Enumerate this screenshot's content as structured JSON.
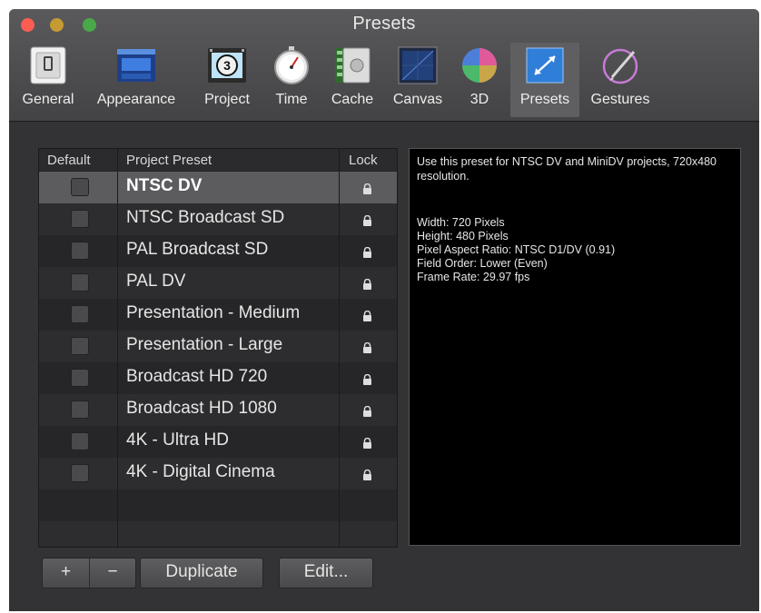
{
  "window": {
    "title": "Presets",
    "controls": [
      "close",
      "minimize",
      "zoom"
    ]
  },
  "toolbar": {
    "items": [
      {
        "label": "General",
        "icon": "switch-icon"
      },
      {
        "label": "Appearance",
        "icon": "window-layout-icon"
      },
      {
        "label": "Project",
        "icon": "film-reel-icon"
      },
      {
        "label": "Time",
        "icon": "stopwatch-icon"
      },
      {
        "label": "Cache",
        "icon": "safe-film-icon"
      },
      {
        "label": "Canvas",
        "icon": "canvas-grid-icon"
      },
      {
        "label": "3D",
        "icon": "sphere-3d-icon"
      },
      {
        "label": "Presets",
        "icon": "resize-arrows-icon",
        "selected": true
      },
      {
        "label": "Gestures",
        "icon": "pen-stroke-icon"
      }
    ]
  },
  "table": {
    "headers": {
      "default": "Default",
      "preset": "Project Preset",
      "lock": "Lock"
    },
    "rows": [
      {
        "name": "NTSC DV",
        "selected": true
      },
      {
        "name": "NTSC Broadcast SD"
      },
      {
        "name": "PAL Broadcast SD"
      },
      {
        "name": "PAL DV"
      },
      {
        "name": "Presentation - Medium"
      },
      {
        "name": "Presentation - Large"
      },
      {
        "name": "Broadcast HD 720"
      },
      {
        "name": "Broadcast HD 1080"
      },
      {
        "name": "4K - Ultra HD"
      },
      {
        "name": "4K - Digital Cinema"
      }
    ]
  },
  "description": {
    "intro": "Use this preset for NTSC DV and MiniDV projects, 720x480 resolution.",
    "specs": [
      "Width: 720 Pixels",
      "Height: 480 Pixels",
      "Pixel Aspect Ratio: NTSC D1/DV (0.91)",
      "Field Order: Lower (Even)",
      "Frame Rate: 29.97 fps"
    ]
  },
  "buttons": {
    "add": "+",
    "remove": "−",
    "duplicate": "Duplicate",
    "edit": "Edit..."
  },
  "colors": {
    "window_bg": "#333335",
    "selected_row": "#5c5c5f",
    "close": "#fc5d53",
    "minimize": "#c49a33",
    "zoom": "#4aa84a"
  }
}
